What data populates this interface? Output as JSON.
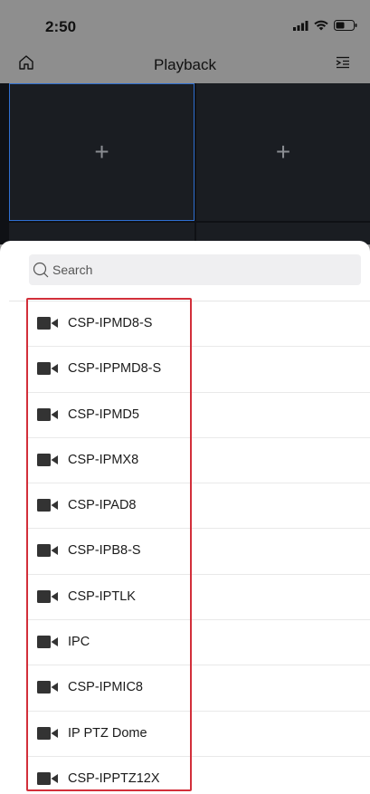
{
  "status_bar": {
    "time": "2:50"
  },
  "nav": {
    "title": "Playback"
  },
  "panes": {
    "add_symbol": "+"
  },
  "search": {
    "placeholder": "Search"
  },
  "devices": [
    "CSP-IPMD8-S",
    "CSP-IPPMD8-S",
    "CSP-IPMD5",
    "CSP-IPMX8",
    "CSP-IPAD8",
    "CSP-IPB8-S",
    "CSP-IPTLK",
    "IPC",
    "CSP-IPMIC8",
    "IP PTZ Dome",
    "CSP-IPPTZ12X"
  ],
  "colors": {
    "highlight": "#d22f3a",
    "selected_pane_border": "#2f6fd1"
  }
}
